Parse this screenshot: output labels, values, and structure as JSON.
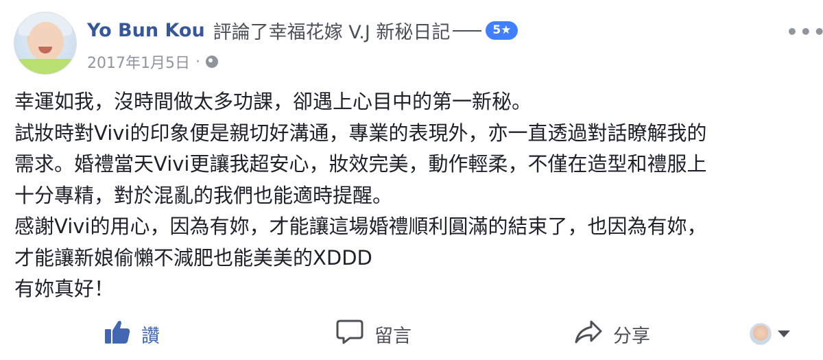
{
  "post": {
    "author": "Yo Bun Kou",
    "action_text": "評論了幸福花嫁 V.J 新秘日記",
    "rating_badge": "5★",
    "date": "2017年1月5日",
    "separator": "·",
    "privacy_icon": "globe-icon",
    "more_icon": "ellipsis-icon",
    "more_label": "•••",
    "lines": [
      "幸運如我，沒時間做太多功課，卻遇上心目中的第一新秘。",
      "試妝時對Vivi的印象便是親切好溝通，專業的表現外，亦一直透過對話瞭解我的",
      "需求。婚禮當天Vivi更讓我超安心，妝效完美，動作輕柔，不僅在造型和禮服上",
      "十分專精，對於混亂的我們也能適時提醒。",
      "感謝Vivi的用心，因為有妳，才能讓這場婚禮順利圓滿的結束了，也因為有妳，",
      "才能讓新娘偷懶不減肥也能美美的XDDD",
      "有妳真好！"
    ]
  },
  "actions": {
    "like": {
      "label": "讚",
      "icon": "thumbs-up-icon"
    },
    "comment": {
      "label": "留言",
      "icon": "comment-icon"
    },
    "share": {
      "label": "分享",
      "icon": "share-icon"
    }
  },
  "colors": {
    "author": "#365899",
    "rating_badge": "#4080ff",
    "like_active": "#4267b2",
    "meta": "#90949c",
    "text": "#1d2129"
  }
}
